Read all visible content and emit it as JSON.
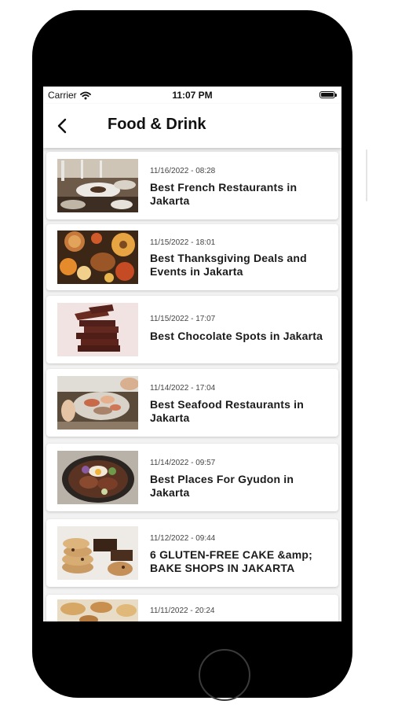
{
  "status_bar": {
    "carrier": "Carrier",
    "time": "11:07 PM"
  },
  "nav": {
    "title": "Food & Drink"
  },
  "articles": [
    {
      "date": "11/16/2022 - 08:28",
      "title": "Best French Restaurants in Jakarta",
      "image": "french-restaurant-image"
    },
    {
      "date": "11/15/2022 - 18:01",
      "title": "Best Thanksgiving Deals and Events in Jakarta",
      "image": "thanksgiving-feast-image"
    },
    {
      "date": "11/15/2022 - 17:07",
      "title": "Best Chocolate Spots in Jakarta",
      "image": "chocolate-stack-image"
    },
    {
      "date": "11/14/2022 - 17:04",
      "title": "Best Seafood Restaurants in Jakarta",
      "image": "seafood-platter-image"
    },
    {
      "date": "11/14/2022 - 09:57",
      "title": "Best Places For Gyudon in Jakarta",
      "image": "gyudon-bowl-image"
    },
    {
      "date": "11/12/2022 - 09:44",
      "title": "6 GLUTEN-FREE CAKE &amp; BAKE SHOPS IN JAKARTA",
      "image": "cookies-image"
    },
    {
      "date": "11/11/2022 - 20:24",
      "title": "",
      "image": "pastry-image"
    }
  ]
}
